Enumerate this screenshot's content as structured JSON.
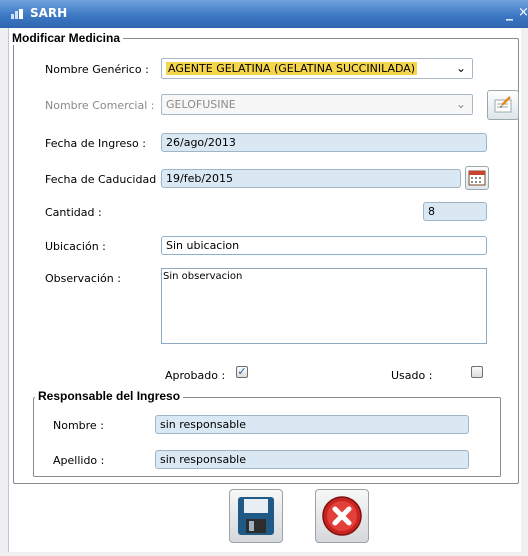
{
  "window": {
    "title": "SARH",
    "minimize": "_",
    "close": "×"
  },
  "form": {
    "legend": "Modificar Medicina",
    "nombre_generico": {
      "label": "Nombre Genérico :",
      "value": "AGENTE GELATINA (GELATINA SUCCINILADA)"
    },
    "nombre_comercial": {
      "label": "Nombre Comercial :",
      "value": "GELOFUSINE"
    },
    "fecha_ingreso": {
      "label": "Fecha de Ingreso :",
      "value": "26/ago/2013"
    },
    "fecha_caducidad": {
      "label": "Fecha de Caducidad :",
      "value": "19/feb/2015"
    },
    "cantidad": {
      "label": "Cantidad :",
      "value": "8"
    },
    "ubicacion": {
      "label": "Ubicación :",
      "value": "Sin ubicacion"
    },
    "observacion": {
      "label": "Observación :",
      "value": "Sin observacion"
    },
    "aprobado": {
      "label": "Aprobado :",
      "checked": true
    },
    "usado": {
      "label": "Usado :",
      "checked": false
    }
  },
  "responsable": {
    "legend": "Responsable del Ingreso",
    "nombre": {
      "label": "Nombre :",
      "value": "sin responsable"
    },
    "apellido": {
      "label": "Apellido :",
      "value": "sin responsable"
    }
  },
  "icons": {
    "save": "floppy-disk-icon",
    "cancel": "red-x-icon",
    "edit": "edit-note-icon",
    "calendar": "calendar-icon"
  }
}
